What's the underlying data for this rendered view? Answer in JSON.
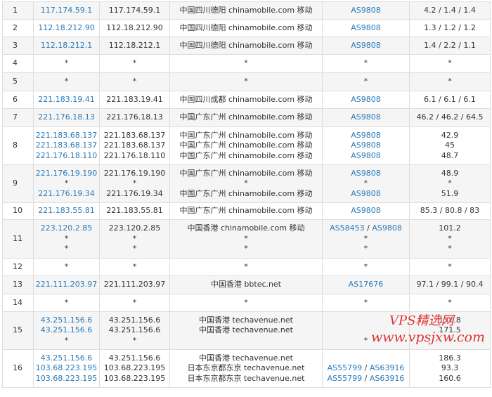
{
  "hops": [
    {
      "hop": "1",
      "rows": [
        {
          "host": "117.174.59.1",
          "ip": "117.174.59.1",
          "location": "中国四川德阳 chinamobile.com 移动",
          "as": [
            "AS9808"
          ],
          "time": "4.2 / 1.4 / 1.4"
        }
      ]
    },
    {
      "hop": "2",
      "rows": [
        {
          "host": "112.18.212.90",
          "ip": "112.18.212.90",
          "location": "中国四川德阳 chinamobile.com 移动",
          "as": [
            "AS9808"
          ],
          "time": "1.3 / 1.2 / 1.2"
        }
      ]
    },
    {
      "hop": "3",
      "rows": [
        {
          "host": "112.18.212.1",
          "ip": "112.18.212.1",
          "location": "中国四川德阳 chinamobile.com 移动",
          "as": [
            "AS9808"
          ],
          "time": "1.4 / 2.2 / 1.1"
        }
      ]
    },
    {
      "hop": "4",
      "rows": [
        {
          "host": "*",
          "ip": "*",
          "location": "*",
          "as": [
            "*"
          ],
          "time": "*"
        }
      ]
    },
    {
      "hop": "5",
      "rows": [
        {
          "host": "*",
          "ip": "*",
          "location": "*",
          "as": [
            "*"
          ],
          "time": "*"
        }
      ]
    },
    {
      "hop": "6",
      "rows": [
        {
          "host": "221.183.19.41",
          "ip": "221.183.19.41",
          "location": "中国四川成都 chinamobile.com 移动",
          "as": [
            "AS9808"
          ],
          "time": "6.1 / 6.1 / 6.1"
        }
      ]
    },
    {
      "hop": "7",
      "rows": [
        {
          "host": "221.176.18.13",
          "ip": "221.176.18.13",
          "location": "中国广东广州 chinamobile.com 移动",
          "as": [
            "AS9808"
          ],
          "time": "46.2 / 46.2 / 64.5"
        }
      ]
    },
    {
      "hop": "8",
      "rows": [
        {
          "host": "221.183.68.137",
          "ip": "221.183.68.137",
          "location": "中国广东广州 chinamobile.com 移动",
          "as": [
            "AS9808"
          ],
          "time": "42.9"
        },
        {
          "host": "221.183.68.137",
          "ip": "221.183.68.137",
          "location": "中国广东广州 chinamobile.com 移动",
          "as": [
            "AS9808"
          ],
          "time": "45"
        },
        {
          "host": "221.176.18.110",
          "ip": "221.176.18.110",
          "location": "中国广东广州 chinamobile.com 移动",
          "as": [
            "AS9808"
          ],
          "time": "48.7"
        }
      ]
    },
    {
      "hop": "9",
      "rows": [
        {
          "host": "221.176.19.190",
          "ip": "221.176.19.190",
          "location": "中国广东广州 chinamobile.com 移动",
          "as": [
            "AS9808"
          ],
          "time": "48.9"
        },
        {
          "host": "*",
          "ip": "*",
          "location": "*",
          "as": [
            "*"
          ],
          "time": "*"
        },
        {
          "host": "221.176.19.34",
          "ip": "221.176.19.34",
          "location": "中国广东广州 chinamobile.com 移动",
          "as": [
            "AS9808"
          ],
          "time": "51.9"
        }
      ]
    },
    {
      "hop": "10",
      "rows": [
        {
          "host": "221.183.55.81",
          "ip": "221.183.55.81",
          "location": "中国广东广州 chinamobile.com 移动",
          "as": [
            "AS9808"
          ],
          "time": "85.3 / 80.8 / 83"
        }
      ]
    },
    {
      "hop": "11",
      "rows": [
        {
          "host": "223.120.2.85",
          "ip": "223.120.2.85",
          "location": "中国香港 chinamobile.com 移动",
          "as": [
            "AS58453",
            "AS9808"
          ],
          "time": "101.2"
        },
        {
          "host": "*",
          "ip": "*",
          "location": "*",
          "as": [
            "*"
          ],
          "time": "*"
        },
        {
          "host": "*",
          "ip": "*",
          "location": "*",
          "as": [
            "*"
          ],
          "time": "*"
        }
      ]
    },
    {
      "hop": "12",
      "rows": [
        {
          "host": "*",
          "ip": "*",
          "location": "*",
          "as": [
            "*"
          ],
          "time": "*"
        }
      ]
    },
    {
      "hop": "13",
      "rows": [
        {
          "host": "221.111.203.97",
          "ip": "221.111.203.97",
          "location": "中国香港 bbtec.net",
          "as": [
            "AS17676"
          ],
          "time": "97.1 / 99.1 / 90.4"
        }
      ]
    },
    {
      "hop": "14",
      "rows": [
        {
          "host": "*",
          "ip": "*",
          "location": "*",
          "as": [
            "*"
          ],
          "time": "*"
        }
      ]
    },
    {
      "hop": "15",
      "rows": [
        {
          "host": "43.251.156.6",
          "ip": "43.251.156.6",
          "location": "中国香港 techavenue.net",
          "as": [
            ""
          ],
          "time": "158.8"
        },
        {
          "host": "43.251.156.6",
          "ip": "43.251.156.6",
          "location": "中国香港 techavenue.net",
          "as": [
            ""
          ],
          "time": "171.5"
        },
        {
          "host": "*",
          "ip": "*",
          "location": "",
          "as": [
            "*"
          ],
          "time": "*"
        }
      ]
    },
    {
      "hop": "16",
      "rows": [
        {
          "host": "43.251.156.6",
          "ip": "43.251.156.6",
          "location": "中国香港 techavenue.net",
          "as": [
            ""
          ],
          "time": "186.3"
        },
        {
          "host": "103.68.223.195",
          "ip": "103.68.223.195",
          "location": "日本东京都东京 techavenue.net",
          "as": [
            "AS55799",
            "AS63916"
          ],
          "time": "93.3"
        },
        {
          "host": "103.68.223.195",
          "ip": "103.68.223.195",
          "location": "日本东京都东京 techavenue.net",
          "as": [
            "AS55799",
            "AS63916"
          ],
          "time": "160.6"
        }
      ]
    }
  ],
  "watermark": {
    "line1": "VPS精选网",
    "line2": "www.vpsjxw.com"
  },
  "colors": {
    "link": "#2a7ab8",
    "odd_row": "#f5f5f5",
    "border": "#dddddd",
    "watermark": "#d93030"
  }
}
